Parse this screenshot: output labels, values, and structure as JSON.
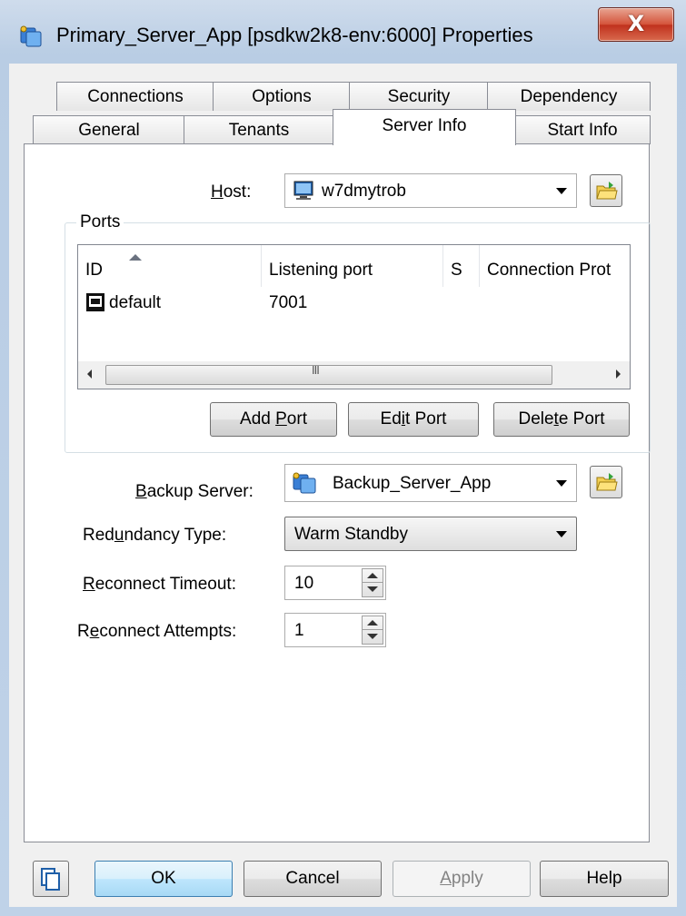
{
  "window": {
    "title": "Primary_Server_App [psdkw2k8-env:6000] Properties",
    "close_label": "X"
  },
  "tabs": {
    "row1": [
      "Connections",
      "Options",
      "Security",
      "Dependency"
    ],
    "row2": [
      "General",
      "Tenants",
      "Server Info",
      "Start Info"
    ],
    "active": "Server Info"
  },
  "server_info": {
    "host_label_pre": "",
    "host_label_u": "H",
    "host_label_post": "ost:",
    "host_value": "w7dmytrob",
    "ports": {
      "legend": "Ports",
      "columns": [
        "ID",
        "Listening port",
        "S",
        "Connection Prot"
      ],
      "rows": [
        {
          "id": "default",
          "port": "7001",
          "s": "",
          "protocol": ""
        }
      ],
      "scroll_grip": "III",
      "add_pre": "Add ",
      "add_u": "P",
      "add_post": "ort",
      "edit_pre": "Ed",
      "edit_u": "i",
      "edit_post": "t Port",
      "delete_pre": "Dele",
      "delete_u": "t",
      "delete_post": "e Port"
    },
    "backup_label_pre": "",
    "backup_label_u": "B",
    "backup_label_post": "ackup Server:",
    "backup_value": "Backup_Server_App",
    "redundancy_label_pre": "Red",
    "redundancy_label_u": "u",
    "redundancy_label_post": "ndancy Type:",
    "redundancy_value": "Warm Standby",
    "timeout_label_pre": "",
    "timeout_label_u": "R",
    "timeout_label_post": "econnect Timeout:",
    "timeout_value": "10",
    "attempts_label_pre": "R",
    "attempts_label_u": "e",
    "attempts_label_post": "connect Attempts:",
    "attempts_value": "1"
  },
  "footer": {
    "ok": "OK",
    "cancel": "Cancel",
    "apply_u": "A",
    "apply_post": "pply",
    "help": "Help"
  }
}
